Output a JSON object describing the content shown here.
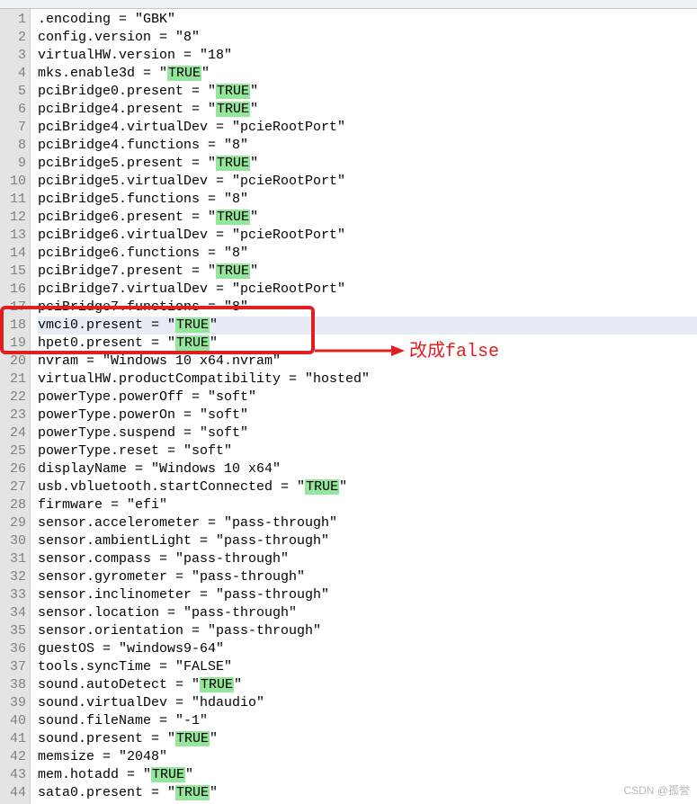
{
  "annotation_text": "改成false",
  "watermark": "CSDN @孤誉",
  "highlight_word": "TRUE",
  "lines": [
    {
      "n": 1,
      "pre": ".encoding = \"GBK\"",
      "hl": "",
      "post": ""
    },
    {
      "n": 2,
      "pre": "config.version = \"8\"",
      "hl": "",
      "post": ""
    },
    {
      "n": 3,
      "pre": "virtualHW.version = \"18\"",
      "hl": "",
      "post": ""
    },
    {
      "n": 4,
      "pre": "mks.enable3d = \"",
      "hl": "TRUE",
      "post": "\""
    },
    {
      "n": 5,
      "pre": "pciBridge0.present = \"",
      "hl": "TRUE",
      "post": "\""
    },
    {
      "n": 6,
      "pre": "pciBridge4.present = \"",
      "hl": "TRUE",
      "post": "\""
    },
    {
      "n": 7,
      "pre": "pciBridge4.virtualDev = \"pcieRootPort\"",
      "hl": "",
      "post": ""
    },
    {
      "n": 8,
      "pre": "pciBridge4.functions = \"8\"",
      "hl": "",
      "post": ""
    },
    {
      "n": 9,
      "pre": "pciBridge5.present = \"",
      "hl": "TRUE",
      "post": "\""
    },
    {
      "n": 10,
      "pre": "pciBridge5.virtualDev = \"pcieRootPort\"",
      "hl": "",
      "post": ""
    },
    {
      "n": 11,
      "pre": "pciBridge5.functions = \"8\"",
      "hl": "",
      "post": ""
    },
    {
      "n": 12,
      "pre": "pciBridge6.present = \"",
      "hl": "TRUE",
      "post": "\""
    },
    {
      "n": 13,
      "pre": "pciBridge6.virtualDev = \"pcieRootPort\"",
      "hl": "",
      "post": ""
    },
    {
      "n": 14,
      "pre": "pciBridge6.functions = \"8\"",
      "hl": "",
      "post": ""
    },
    {
      "n": 15,
      "pre": "pciBridge7.present = \"",
      "hl": "TRUE",
      "post": "\""
    },
    {
      "n": 16,
      "pre": "pciBridge7.virtualDev = \"pcieRootPort\"",
      "hl": "",
      "post": ""
    },
    {
      "n": 17,
      "pre": "pciBridge7.functions = \"8\"",
      "hl": "",
      "post": "",
      "obscured": true
    },
    {
      "n": 18,
      "pre": "vmci0.present = \"",
      "hl": "TRUE",
      "post": "\"",
      "highlighted": true
    },
    {
      "n": 19,
      "pre": "hpet0.present = \"",
      "hl": "TRUE",
      "post": "\"",
      "obscured": true
    },
    {
      "n": 20,
      "pre": "nvram = \"Windows 10 x64.nvram\"",
      "hl": "",
      "post": ""
    },
    {
      "n": 21,
      "pre": "virtualHW.productCompatibility = \"hosted\"",
      "hl": "",
      "post": ""
    },
    {
      "n": 22,
      "pre": "powerType.powerOff = \"soft\"",
      "hl": "",
      "post": ""
    },
    {
      "n": 23,
      "pre": "powerType.powerOn = \"soft\"",
      "hl": "",
      "post": ""
    },
    {
      "n": 24,
      "pre": "powerType.suspend = \"soft\"",
      "hl": "",
      "post": ""
    },
    {
      "n": 25,
      "pre": "powerType.reset = \"soft\"",
      "hl": "",
      "post": ""
    },
    {
      "n": 26,
      "pre": "displayName = \"Windows 10 x64\"",
      "hl": "",
      "post": ""
    },
    {
      "n": 27,
      "pre": "usb.vbluetooth.startConnected = \"",
      "hl": "TRUE",
      "post": "\""
    },
    {
      "n": 28,
      "pre": "firmware = \"efi\"",
      "hl": "",
      "post": ""
    },
    {
      "n": 29,
      "pre": "sensor.accelerometer = \"pass-through\"",
      "hl": "",
      "post": ""
    },
    {
      "n": 30,
      "pre": "sensor.ambientLight = \"pass-through\"",
      "hl": "",
      "post": ""
    },
    {
      "n": 31,
      "pre": "sensor.compass = \"pass-through\"",
      "hl": "",
      "post": ""
    },
    {
      "n": 32,
      "pre": "sensor.gyrometer = \"pass-through\"",
      "hl": "",
      "post": ""
    },
    {
      "n": 33,
      "pre": "sensor.inclinometer = \"pass-through\"",
      "hl": "",
      "post": ""
    },
    {
      "n": 34,
      "pre": "sensor.location = \"pass-through\"",
      "hl": "",
      "post": ""
    },
    {
      "n": 35,
      "pre": "sensor.orientation = \"pass-through\"",
      "hl": "",
      "post": ""
    },
    {
      "n": 36,
      "pre": "guestOS = \"windows9-64\"",
      "hl": "",
      "post": ""
    },
    {
      "n": 37,
      "pre": "tools.syncTime = \"FALSE\"",
      "hl": "",
      "post": ""
    },
    {
      "n": 38,
      "pre": "sound.autoDetect = \"",
      "hl": "TRUE",
      "post": "\""
    },
    {
      "n": 39,
      "pre": "sound.virtualDev = \"hdaudio\"",
      "hl": "",
      "post": ""
    },
    {
      "n": 40,
      "pre": "sound.fileName = \"-1\"",
      "hl": "",
      "post": ""
    },
    {
      "n": 41,
      "pre": "sound.present = \"",
      "hl": "TRUE",
      "post": "\""
    },
    {
      "n": 42,
      "pre": "memsize = \"2048\"",
      "hl": "",
      "post": ""
    },
    {
      "n": 43,
      "pre": "mem.hotadd = \"",
      "hl": "TRUE",
      "post": "\""
    },
    {
      "n": 44,
      "pre": "sata0.present = \"",
      "hl": "TRUE",
      "post": "\""
    }
  ]
}
